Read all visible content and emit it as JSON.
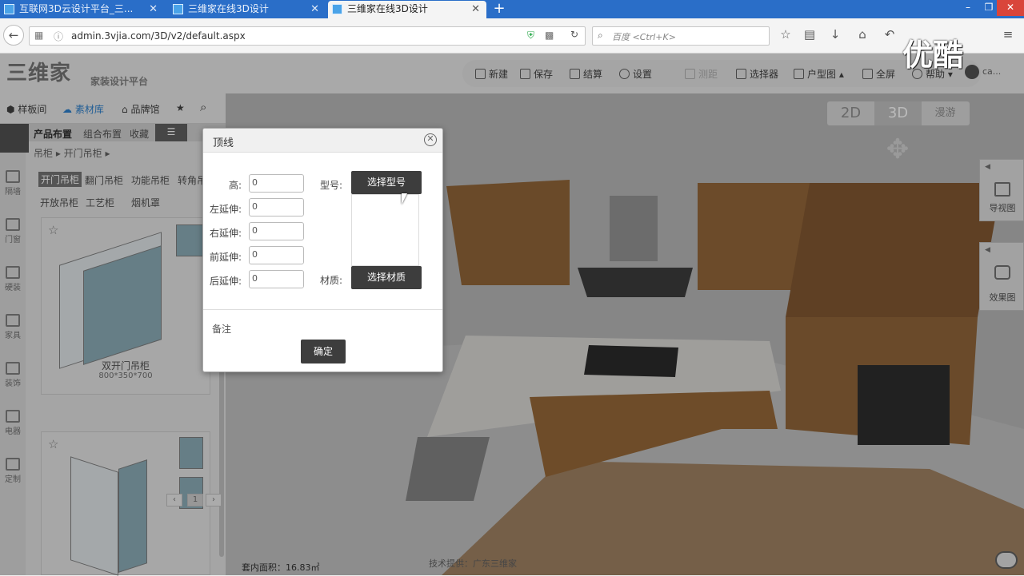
{
  "browser": {
    "tabs": [
      {
        "label": "互联网3D云设计平台_三..."
      },
      {
        "label": "三维家在线3D设计"
      },
      {
        "label": "三维家在线3D设计"
      }
    ],
    "new_tab": "+",
    "url": "admin.3vjia.com/3D/v2/default.aspx",
    "search_placeholder": "百度 <Ctrl+K>"
  },
  "app": {
    "logo": "三维家",
    "logo_sub": "家装设计平台",
    "toolbar": [
      "新建",
      "保存",
      "结算",
      "设置",
      "测距",
      "选择器",
      "户型图",
      "全屏",
      "帮助"
    ],
    "user": "ca..."
  },
  "watermark": "优酷",
  "sidebar": {
    "nav": [
      "样板间",
      "素材库",
      "品牌馆"
    ],
    "cat_tabs": [
      "产品布置",
      "组合布置",
      "收藏"
    ],
    "breadcrumb": "吊柜 ▸   开门吊柜 ▸",
    "subcats": [
      "开门吊柜",
      "翻门吊柜",
      "功能吊柜",
      "转角吊",
      "开放吊柜",
      "工艺柜",
      "烟机罩"
    ],
    "rail": [
      "隔墙",
      "门窗",
      "硬装",
      "家具",
      "装饰",
      "电器",
      "定制"
    ],
    "products": [
      {
        "name": "双开门吊柜",
        "size": "800*350*700"
      }
    ],
    "page": "1"
  },
  "scene": {
    "views": [
      "2D",
      "3D",
      "漫游"
    ],
    "right_panels": [
      "导视图",
      "效果图"
    ],
    "area_label": "套内面积：16.83㎡",
    "credit": "技术提供：广东三维家"
  },
  "dialog": {
    "title": "顶线",
    "fields": [
      {
        "label": "高:",
        "value": "0"
      },
      {
        "label": "左延伸:",
        "value": "0"
      },
      {
        "label": "右延伸:",
        "value": "0"
      },
      {
        "label": "前延伸:",
        "value": "0"
      },
      {
        "label": "后延伸:",
        "value": "0"
      }
    ],
    "model_label": "型号:",
    "model_button": "选择型号",
    "material_label": "材质:",
    "material_button": "选择材质",
    "note_label": "备注",
    "confirm": "确定"
  }
}
